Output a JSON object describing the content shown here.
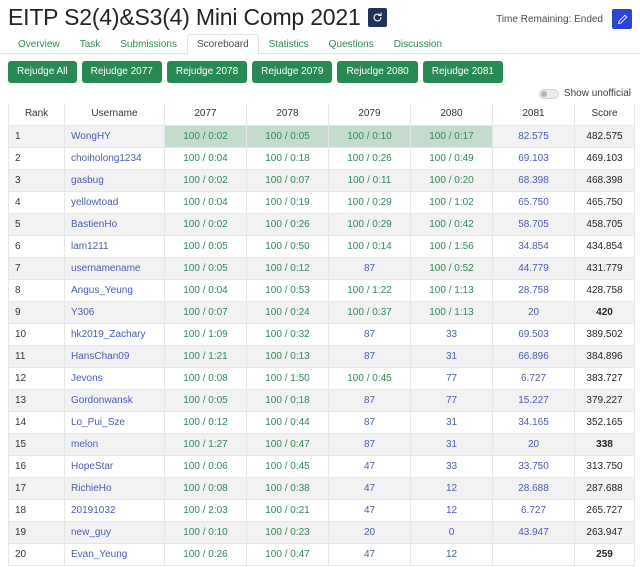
{
  "header": {
    "title": "EITP S2(4)&S3(4) Mini Comp 2021",
    "refresh_icon": "refresh-icon",
    "time_remaining": "Time Remaining: Ended",
    "edit_icon": "edit-icon"
  },
  "tabs": [
    {
      "label": "Overview",
      "active": false
    },
    {
      "label": "Task",
      "active": false
    },
    {
      "label": "Submissions",
      "active": false
    },
    {
      "label": "Scoreboard",
      "active": true
    },
    {
      "label": "Statistics",
      "active": false
    },
    {
      "label": "Questions",
      "active": false
    },
    {
      "label": "Discussion",
      "active": false
    }
  ],
  "rejudge_buttons": [
    {
      "label": "Rejudge All"
    },
    {
      "label": "Rejudge 2077"
    },
    {
      "label": "Rejudge 2078"
    },
    {
      "label": "Rejudge 2079"
    },
    {
      "label": "Rejudge 2080"
    },
    {
      "label": "Rejudge 2081"
    }
  ],
  "toggle": {
    "label": "Show unofficial",
    "state": "off"
  },
  "colors": {
    "green_button": "#278a52",
    "tab_link": "#2e8b57",
    "highlight_cell": "#c3dcce",
    "solved_text": "#2e8b57",
    "link_text": "#4a5bbd",
    "refresh_button": "#1f3257",
    "edit_button": "#2b44d4",
    "row_stripe": "#f2f2f2"
  },
  "table": {
    "columns": [
      "Rank",
      "Username",
      "2077",
      "2078",
      "2079",
      "2080",
      "2081",
      "Score"
    ],
    "rows": [
      {
        "rank": "1",
        "username": "WongHY",
        "p2077": "100 / 0:02",
        "p2078": "100 / 0:05",
        "p2079": "100 / 0:10",
        "p2080": "100 / 0:17",
        "p2081": "82.575",
        "score": "482.575",
        "highlight": [
          2,
          3,
          4,
          5
        ]
      },
      {
        "rank": "2",
        "username": "choiholong1234",
        "p2077": "100 / 0:04",
        "p2078": "100 / 0:18",
        "p2079": "100 / 0:26",
        "p2080": "100 / 0:49",
        "p2081": "69.103",
        "score": "469.103",
        "highlight": []
      },
      {
        "rank": "3",
        "username": "gasbug",
        "p2077": "100 / 0:02",
        "p2078": "100 / 0:07",
        "p2079": "100 / 0:11",
        "p2080": "100 / 0:20",
        "p2081": "68.398",
        "score": "468.398",
        "highlight": []
      },
      {
        "rank": "4",
        "username": "yellowtoad",
        "p2077": "100 / 0:04",
        "p2078": "100 / 0:19",
        "p2079": "100 / 0:29",
        "p2080": "100 / 1:02",
        "p2081": "65.750",
        "score": "465.750",
        "highlight": []
      },
      {
        "rank": "5",
        "username": "BastienHo",
        "p2077": "100 / 0:02",
        "p2078": "100 / 0:26",
        "p2079": "100 / 0:29",
        "p2080": "100 / 0:42",
        "p2081": "58.705",
        "score": "458.705",
        "highlight": []
      },
      {
        "rank": "6",
        "username": "lam1211",
        "p2077": "100 / 0:05",
        "p2078": "100 / 0:50",
        "p2079": "100 / 0:14",
        "p2080": "100 / 1:56",
        "p2081": "34.854",
        "score": "434.854",
        "highlight": []
      },
      {
        "rank": "7",
        "username": "usernamename",
        "p2077": "100 / 0:05",
        "p2078": "100 / 0:12",
        "p2079": "87",
        "p2080": "100 / 0:52",
        "p2081": "44.779",
        "score": "431.779",
        "highlight": []
      },
      {
        "rank": "8",
        "username": "Angus_Yeung",
        "p2077": "100 / 0:04",
        "p2078": "100 / 0:53",
        "p2079": "100 / 1:22",
        "p2080": "100 / 1:13",
        "p2081": "28.758",
        "score": "428.758",
        "highlight": []
      },
      {
        "rank": "9",
        "username": "Y306",
        "p2077": "100 / 0:07",
        "p2078": "100 / 0:24",
        "p2079": "100 / 0:37",
        "p2080": "100 / 1:13",
        "p2081": "20",
        "score": "420",
        "highlight": []
      },
      {
        "rank": "10",
        "username": "hk2019_Zachary",
        "p2077": "100 / 1:09",
        "p2078": "100 / 0:32",
        "p2079": "87",
        "p2080": "33",
        "p2081": "69.503",
        "score": "389.502",
        "highlight": []
      },
      {
        "rank": "11",
        "username": "HansChan09",
        "p2077": "100 / 1:21",
        "p2078": "100 / 0:13",
        "p2079": "87",
        "p2080": "31",
        "p2081": "66.896",
        "score": "384.896",
        "highlight": []
      },
      {
        "rank": "12",
        "username": "Jevons",
        "p2077": "100 / 0:08",
        "p2078": "100 / 1:50",
        "p2079": "100 / 0:45",
        "p2080": "77",
        "p2081": "6.727",
        "score": "383.727",
        "highlight": []
      },
      {
        "rank": "13",
        "username": "Gordonwansk",
        "p2077": "100 / 0:05",
        "p2078": "100 / 0:18",
        "p2079": "87",
        "p2080": "77",
        "p2081": "15.227",
        "score": "379.227",
        "highlight": []
      },
      {
        "rank": "14",
        "username": "Lo_Pui_Sze",
        "p2077": "100 / 0:12",
        "p2078": "100 / 0:44",
        "p2079": "87",
        "p2080": "31",
        "p2081": "34.165",
        "score": "352.165",
        "highlight": []
      },
      {
        "rank": "15",
        "username": "melon",
        "p2077": "100 / 1:27",
        "p2078": "100 / 0:47",
        "p2079": "87",
        "p2080": "31",
        "p2081": "20",
        "score": "338",
        "highlight": []
      },
      {
        "rank": "16",
        "username": "HopeStar",
        "p2077": "100 / 0:06",
        "p2078": "100 / 0:45",
        "p2079": "47",
        "p2080": "33",
        "p2081": "33.750",
        "score": "313.750",
        "highlight": []
      },
      {
        "rank": "17",
        "username": "RichieHo",
        "p2077": "100 / 0:08",
        "p2078": "100 / 0:38",
        "p2079": "47",
        "p2080": "12",
        "p2081": "28.688",
        "score": "287.688",
        "highlight": []
      },
      {
        "rank": "18",
        "username": "20191032",
        "p2077": "100 / 2:03",
        "p2078": "100 / 0:21",
        "p2079": "47",
        "p2080": "12",
        "p2081": "6.727",
        "score": "265.727",
        "highlight": []
      },
      {
        "rank": "19",
        "username": "new_guy",
        "p2077": "100 / 0:10",
        "p2078": "100 / 0:23",
        "p2079": "20",
        "p2080": "0",
        "p2081": "43.947",
        "score": "263.947",
        "highlight": []
      },
      {
        "rank": "20",
        "username": "Evan_Yeung",
        "p2077": "100 / 0:26",
        "p2078": "100 / 0:47",
        "p2079": "47",
        "p2080": "12",
        "p2081": "",
        "score": "259",
        "highlight": []
      }
    ]
  }
}
